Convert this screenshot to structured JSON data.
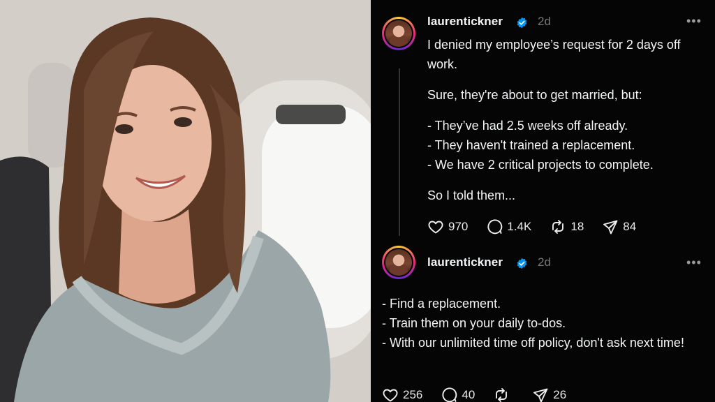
{
  "photo": {
    "alt": "Woman smiling in airplane window seat",
    "colors": {
      "wall": "#d6d0ca",
      "window": "#f6f6f4",
      "hair": "#5c3a26",
      "skin": "#e7b7a0",
      "top": "#9aa6a8"
    }
  },
  "posts": [
    {
      "username": "laurentickner",
      "time": "2d",
      "more_icon": "ellipsis-icon",
      "verified_icon": "verified-badge-icon",
      "paragraphs": [
        "I denied my employee’s request for 2 days off work.",
        "Sure, they're about to get married, but:",
        "- They’ve had 2.5 weeks off already.",
        "- They haven't trained a replacement.",
        "- We have 2 critical projects to complete.",
        "So I told them..."
      ],
      "stats": {
        "likes": "970",
        "comments": "1.4K",
        "reposts": "18",
        "shares": "84"
      }
    },
    {
      "username": "laurentickner",
      "time": "2d",
      "more_icon": "ellipsis-icon",
      "verified_icon": "verified-badge-icon",
      "paragraphs": [
        "- Find a replacement.",
        "- Train them on your daily to-dos.",
        "- With our unlimited time off policy, don't ask next time!"
      ],
      "stats": {
        "likes": "256",
        "comments": "40",
        "reposts": "",
        "shares": "26"
      }
    }
  ],
  "theme": {
    "background": "#050505",
    "text": "#f3f5f7",
    "muted": "#777777",
    "verified": "#0095f6"
  }
}
